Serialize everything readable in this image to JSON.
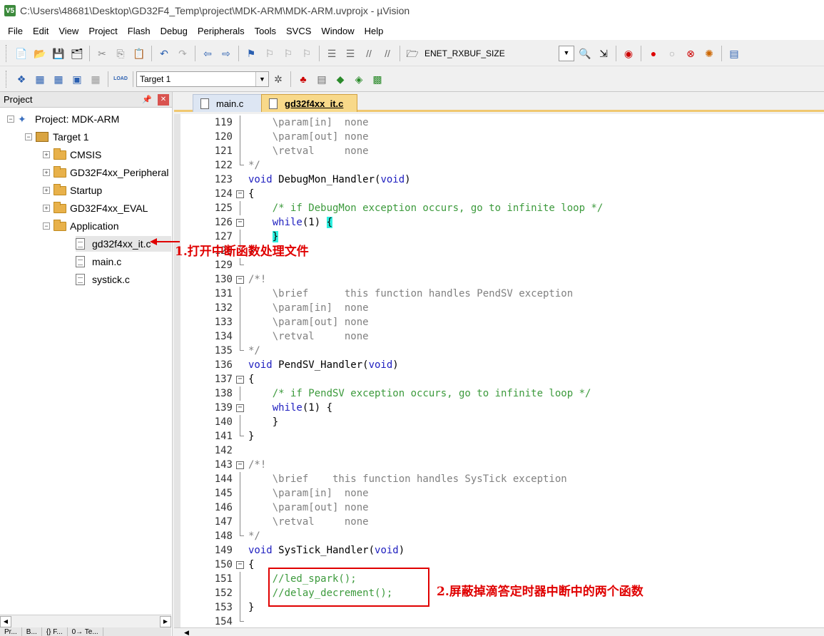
{
  "window": {
    "title": "C:\\Users\\48681\\Desktop\\GD32F4_Temp\\project\\MDK-ARM\\MDK-ARM.uvprojx - µVision",
    "app_icon": "V5"
  },
  "menu": [
    "File",
    "Edit",
    "View",
    "Project",
    "Flash",
    "Debug",
    "Peripherals",
    "Tools",
    "SVCS",
    "Window",
    "Help"
  ],
  "toolbar1": {
    "search_value": "ENET_RXBUF_SIZE"
  },
  "toolbar2": {
    "target_value": "Target 1",
    "load_label": "LOAD"
  },
  "project_panel": {
    "title": "Project",
    "tree": [
      {
        "label": "Project: MDK-ARM"
      },
      {
        "label": "Target 1"
      },
      {
        "label": "CMSIS"
      },
      {
        "label": "GD32F4xx_Peripheral"
      },
      {
        "label": "Startup"
      },
      {
        "label": "GD32F4xx_EVAL"
      },
      {
        "label": "Application"
      },
      {
        "label": "gd32f4xx_it.c"
      },
      {
        "label": "main.c"
      },
      {
        "label": "systick.c"
      }
    ],
    "bottom_tabs": [
      "Pr...",
      "B...",
      "{} F...",
      "0→ Te..."
    ]
  },
  "editor": {
    "tabs": [
      {
        "label": "main.c",
        "active": false
      },
      {
        "label": "gd32f4xx_it.c",
        "active": true
      }
    ],
    "lines": [
      {
        "n": "119",
        "text": "    \\param[in]  none"
      },
      {
        "n": "120",
        "text": "    \\param[out] none"
      },
      {
        "n": "121",
        "text": "    \\retval     none"
      },
      {
        "n": "122",
        "text": "*/"
      },
      {
        "n": "123",
        "text": "void DebugMon_Handler(void)"
      },
      {
        "n": "124",
        "text": "{"
      },
      {
        "n": "125",
        "text": "    /* if DebugMon exception occurs, go to infinite loop */"
      },
      {
        "n": "126",
        "text": "    while(1) {"
      },
      {
        "n": "127",
        "text": "    }"
      },
      {
        "n": "128",
        "text": "}"
      },
      {
        "n": "129",
        "text": ""
      },
      {
        "n": "130",
        "text": "/*!"
      },
      {
        "n": "131",
        "text": "    \\brief      this function handles PendSV exception"
      },
      {
        "n": "132",
        "text": "    \\param[in]  none"
      },
      {
        "n": "133",
        "text": "    \\param[out] none"
      },
      {
        "n": "134",
        "text": "    \\retval     none"
      },
      {
        "n": "135",
        "text": "*/"
      },
      {
        "n": "136",
        "text": "void PendSV_Handler(void)"
      },
      {
        "n": "137",
        "text": "{"
      },
      {
        "n": "138",
        "text": "    /* if PendSV exception occurs, go to infinite loop */"
      },
      {
        "n": "139",
        "text": "    while(1) {"
      },
      {
        "n": "140",
        "text": "    }"
      },
      {
        "n": "141",
        "text": "}"
      },
      {
        "n": "142",
        "text": ""
      },
      {
        "n": "143",
        "text": "/*!"
      },
      {
        "n": "144",
        "text": "    \\brief    this function handles SysTick exception"
      },
      {
        "n": "145",
        "text": "    \\param[in]  none"
      },
      {
        "n": "146",
        "text": "    \\param[out] none"
      },
      {
        "n": "147",
        "text": "    \\retval     none"
      },
      {
        "n": "148",
        "text": "*/"
      },
      {
        "n": "149",
        "text": "void SysTick_Handler(void)"
      },
      {
        "n": "150",
        "text": "{"
      },
      {
        "n": "151",
        "text": "    //led_spark();"
      },
      {
        "n": "152",
        "text": "    //delay_decrement();"
      },
      {
        "n": "153",
        "text": "}"
      },
      {
        "n": "154",
        "text": ""
      }
    ]
  },
  "annotations": {
    "note1": "1.打开中断函数处理文件",
    "note2": "2.屏蔽掉滴答定时器中断中的两个函数"
  },
  "colors": {
    "annotation": "#e00000",
    "keyword": "#2020c0",
    "comment": "#3c9a3c",
    "brace_highlight": "#2ef0e0",
    "active_tab": "#f8d98a"
  }
}
